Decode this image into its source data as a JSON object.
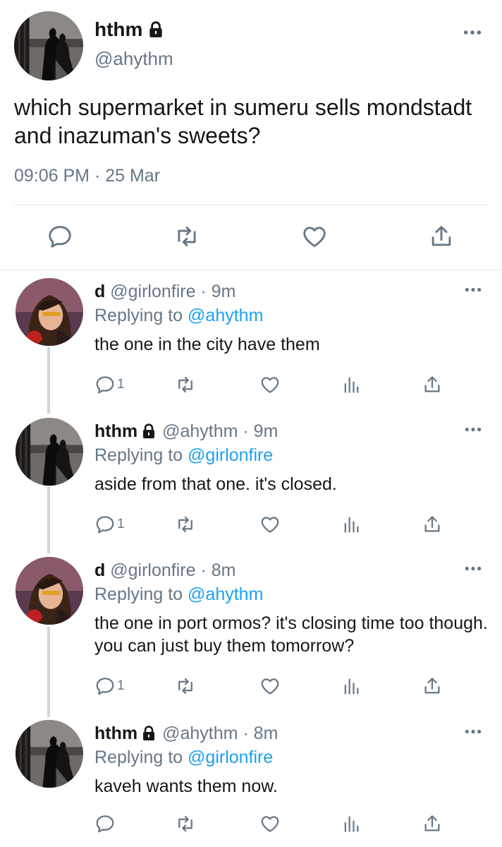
{
  "main_tweet": {
    "display_name": "hthm",
    "handle": "@ahythm",
    "text": "which supermarket in sumeru sells mondstadt and inazuman's sweets?",
    "timestamp": "09:06 PM · 25 Mar",
    "actions": [
      "reply-icon",
      "retweet-icon",
      "like-icon",
      "share-icon"
    ]
  },
  "replies": [
    {
      "display_name": "d",
      "handle": "@girlonfire",
      "time": "· 9m",
      "replying_prefix": "Replying to",
      "replying_to": "@ahythm",
      "text": "the one in the city have them",
      "reply_count": "1",
      "locked": false
    },
    {
      "display_name": "hthm",
      "handle": "@ahythm",
      "time": "· 9m",
      "replying_prefix": "Replying to",
      "replying_to": "@girlonfire",
      "text": "aside from that one. it's closed.",
      "reply_count": "1",
      "locked": true
    },
    {
      "display_name": "d",
      "handle": "@girlonfire",
      "time": "· 8m",
      "replying_prefix": "Replying to",
      "replying_to": "@ahythm",
      "text": "the one in port ormos? it's closing time too though. you can just buy them tomorrow?",
      "reply_count": "1",
      "locked": false
    },
    {
      "display_name": "hthm",
      "handle": "@ahythm",
      "time": "· 8m",
      "replying_prefix": "Replying to",
      "replying_to": "@girlonfire",
      "text": "kaveh wants them now.",
      "reply_count": "",
      "locked": true
    }
  ],
  "colors": {
    "link": "#1da1f2",
    "secondary_text": "#657786",
    "divider": "#e1e8ed",
    "thread_line": "#ccd6dd"
  }
}
